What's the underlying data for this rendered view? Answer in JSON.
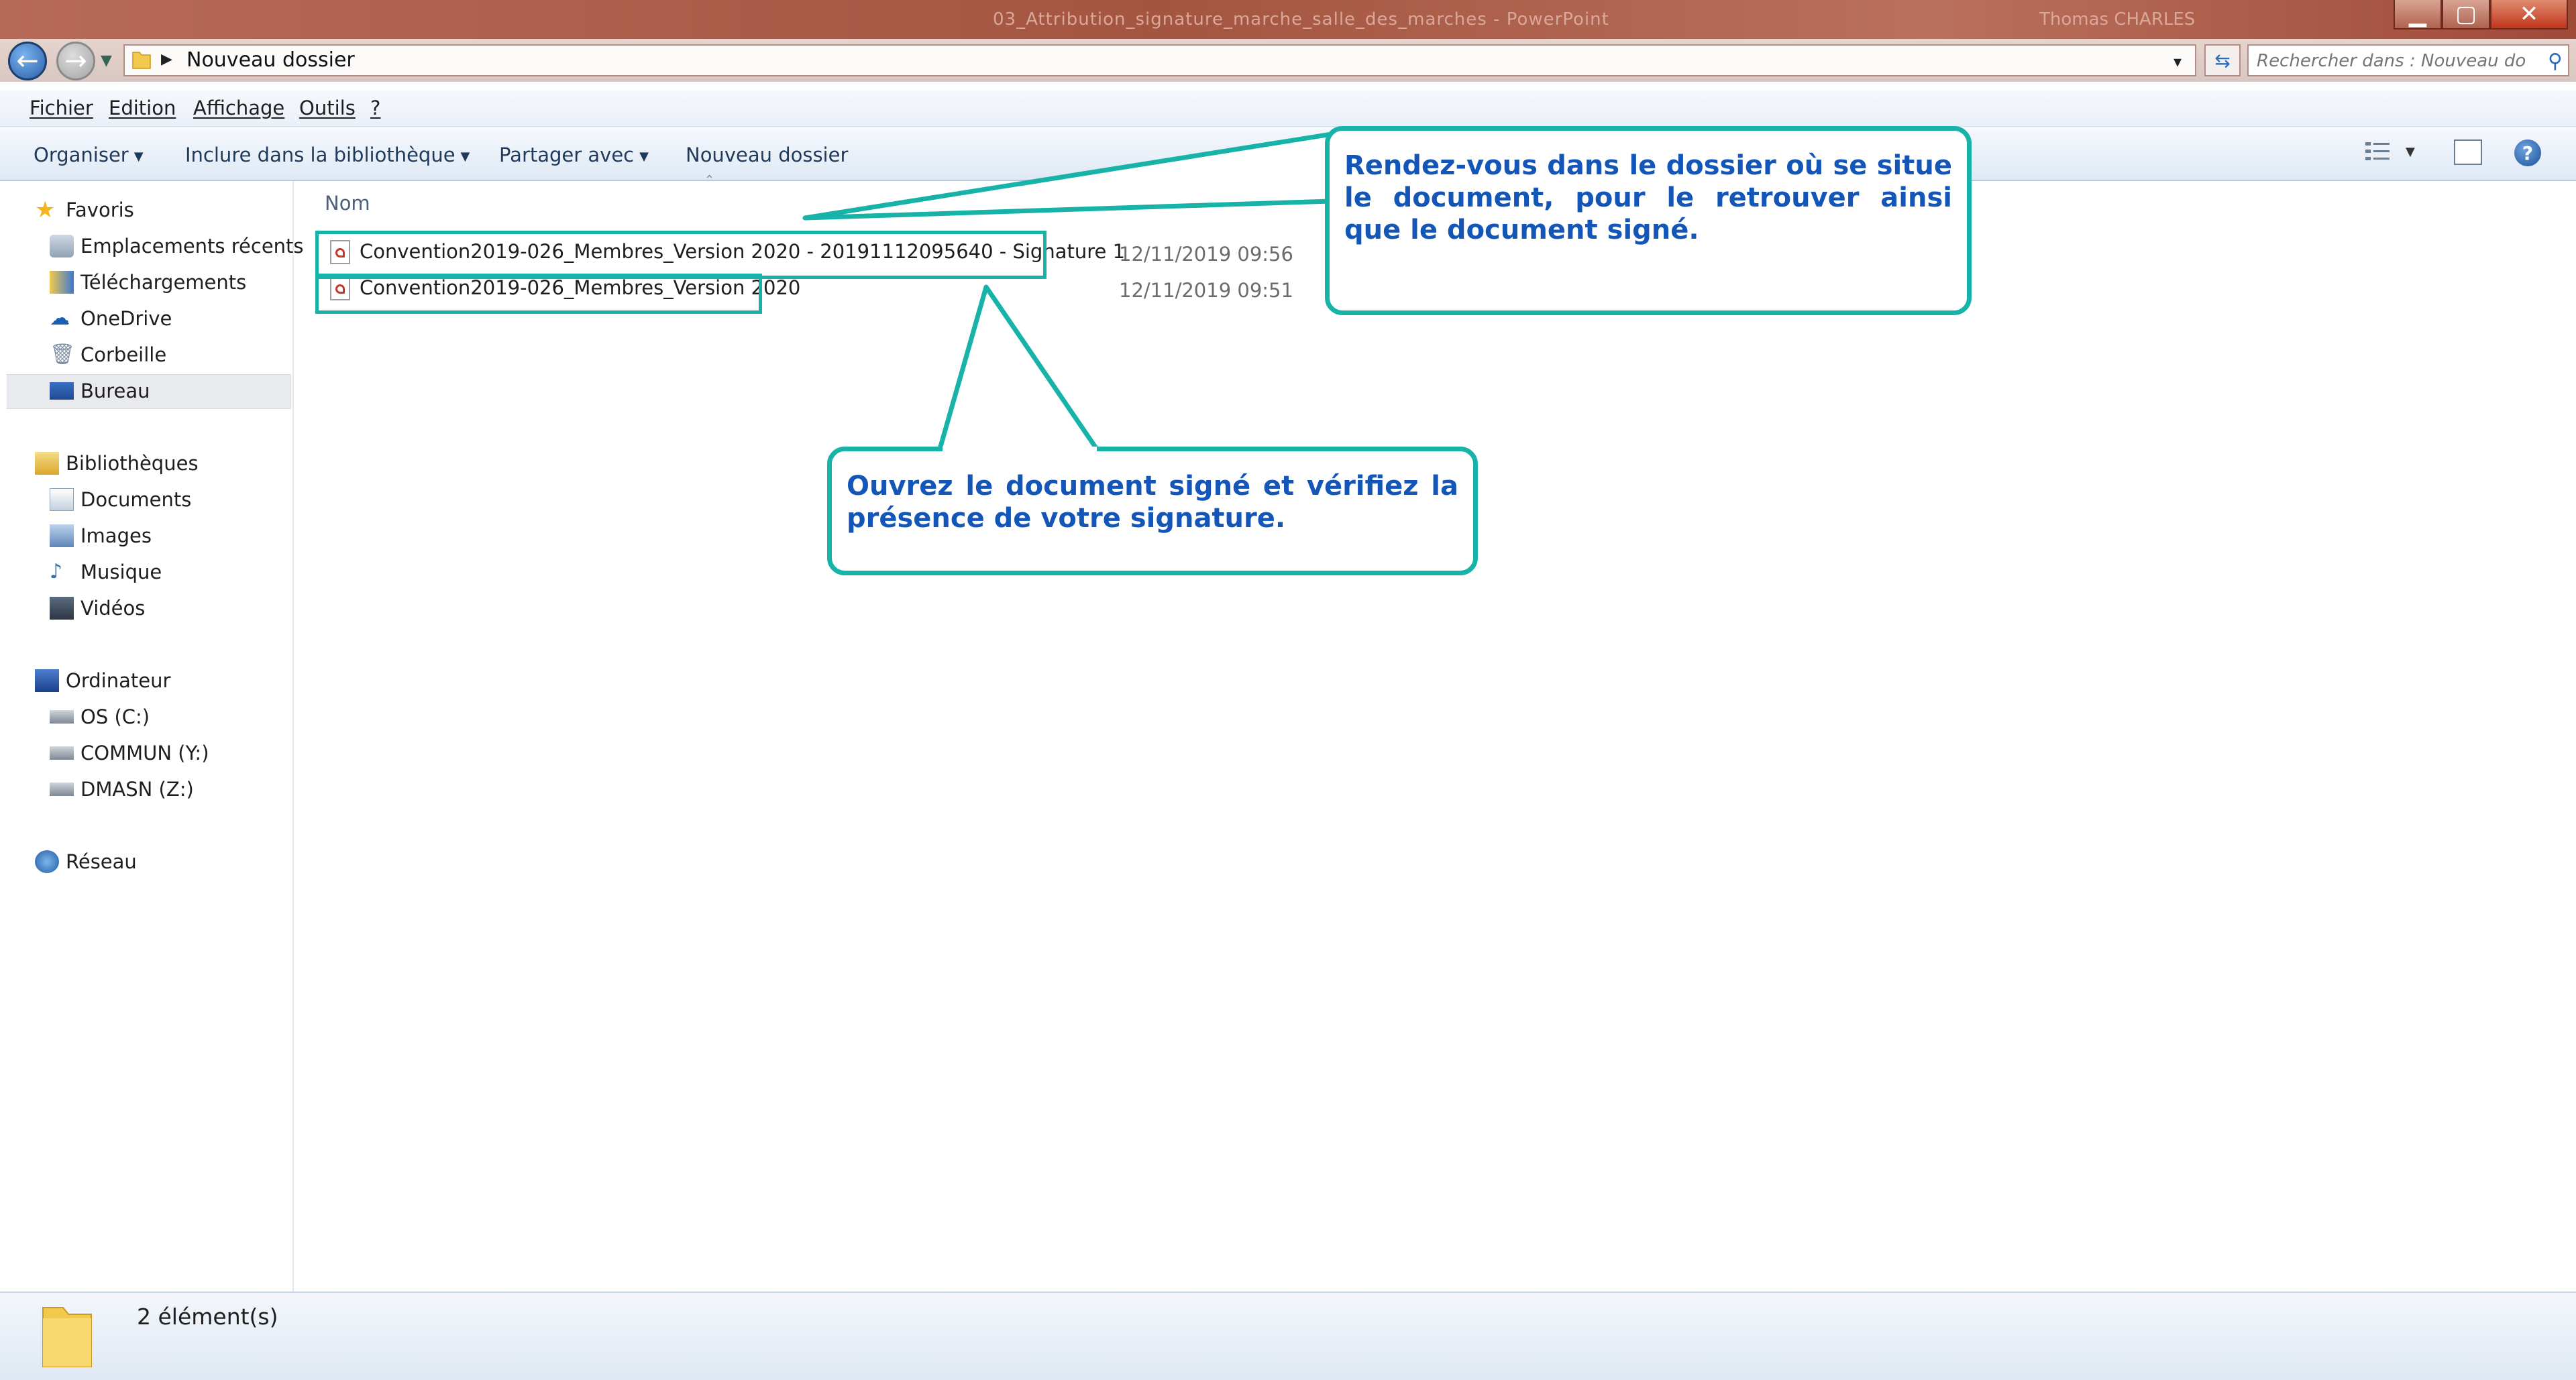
{
  "window": {
    "title": "03_Attribution_signature_marche_salle_des_marches - PowerPoint",
    "user": "Thomas CHARLES"
  },
  "address": {
    "path": "Nouveau dossier",
    "search_placeholder": "Rechercher dans : Nouveau do..."
  },
  "menu": [
    "Fichier",
    "Edition",
    "Affichage",
    "Outils",
    "?"
  ],
  "toolbar": {
    "organiser": "Organiser",
    "inclure": "Inclure dans la bibliothèque",
    "partager": "Partager avec",
    "nouveau_dossier": "Nouveau dossier"
  },
  "nav": {
    "favoris": "Favoris",
    "emplacements": "Emplacements récents",
    "telechargements": "Téléchargements",
    "onedrive": "OneDrive",
    "corbeille": "Corbeille",
    "bureau": "Bureau",
    "bibliotheques": "Bibliothèques",
    "documents": "Documents",
    "images": "Images",
    "musique": "Musique",
    "videos": "Vidéos",
    "ordinateur": "Ordinateur",
    "os": "OS (C:)",
    "commun": "COMMUN (Y:)",
    "dmasn": "DMASN (Z:)",
    "reseau": "Réseau"
  },
  "columns": {
    "name": "Nom"
  },
  "files": [
    {
      "name": "Convention2019-026_Membres_Version 2020 - 20191112095640 - Signature 1",
      "date": "12/11/2019 09:56"
    },
    {
      "name": "Convention2019-026_Membres_Version 2020",
      "date": "12/11/2019 09:51"
    }
  ],
  "callouts": {
    "top": "Rendez-vous dans le dossier où se situe le document, pour le retrouver ainsi que le document  signé.",
    "bottom": "Ouvrez le document signé et vérifiez la présence de votre signature."
  },
  "status": {
    "count": "2 élément(s)"
  },
  "colors": {
    "callout_border": "#17b2a8",
    "callout_text": "#1356b7",
    "titlebar": "#a4553f"
  }
}
